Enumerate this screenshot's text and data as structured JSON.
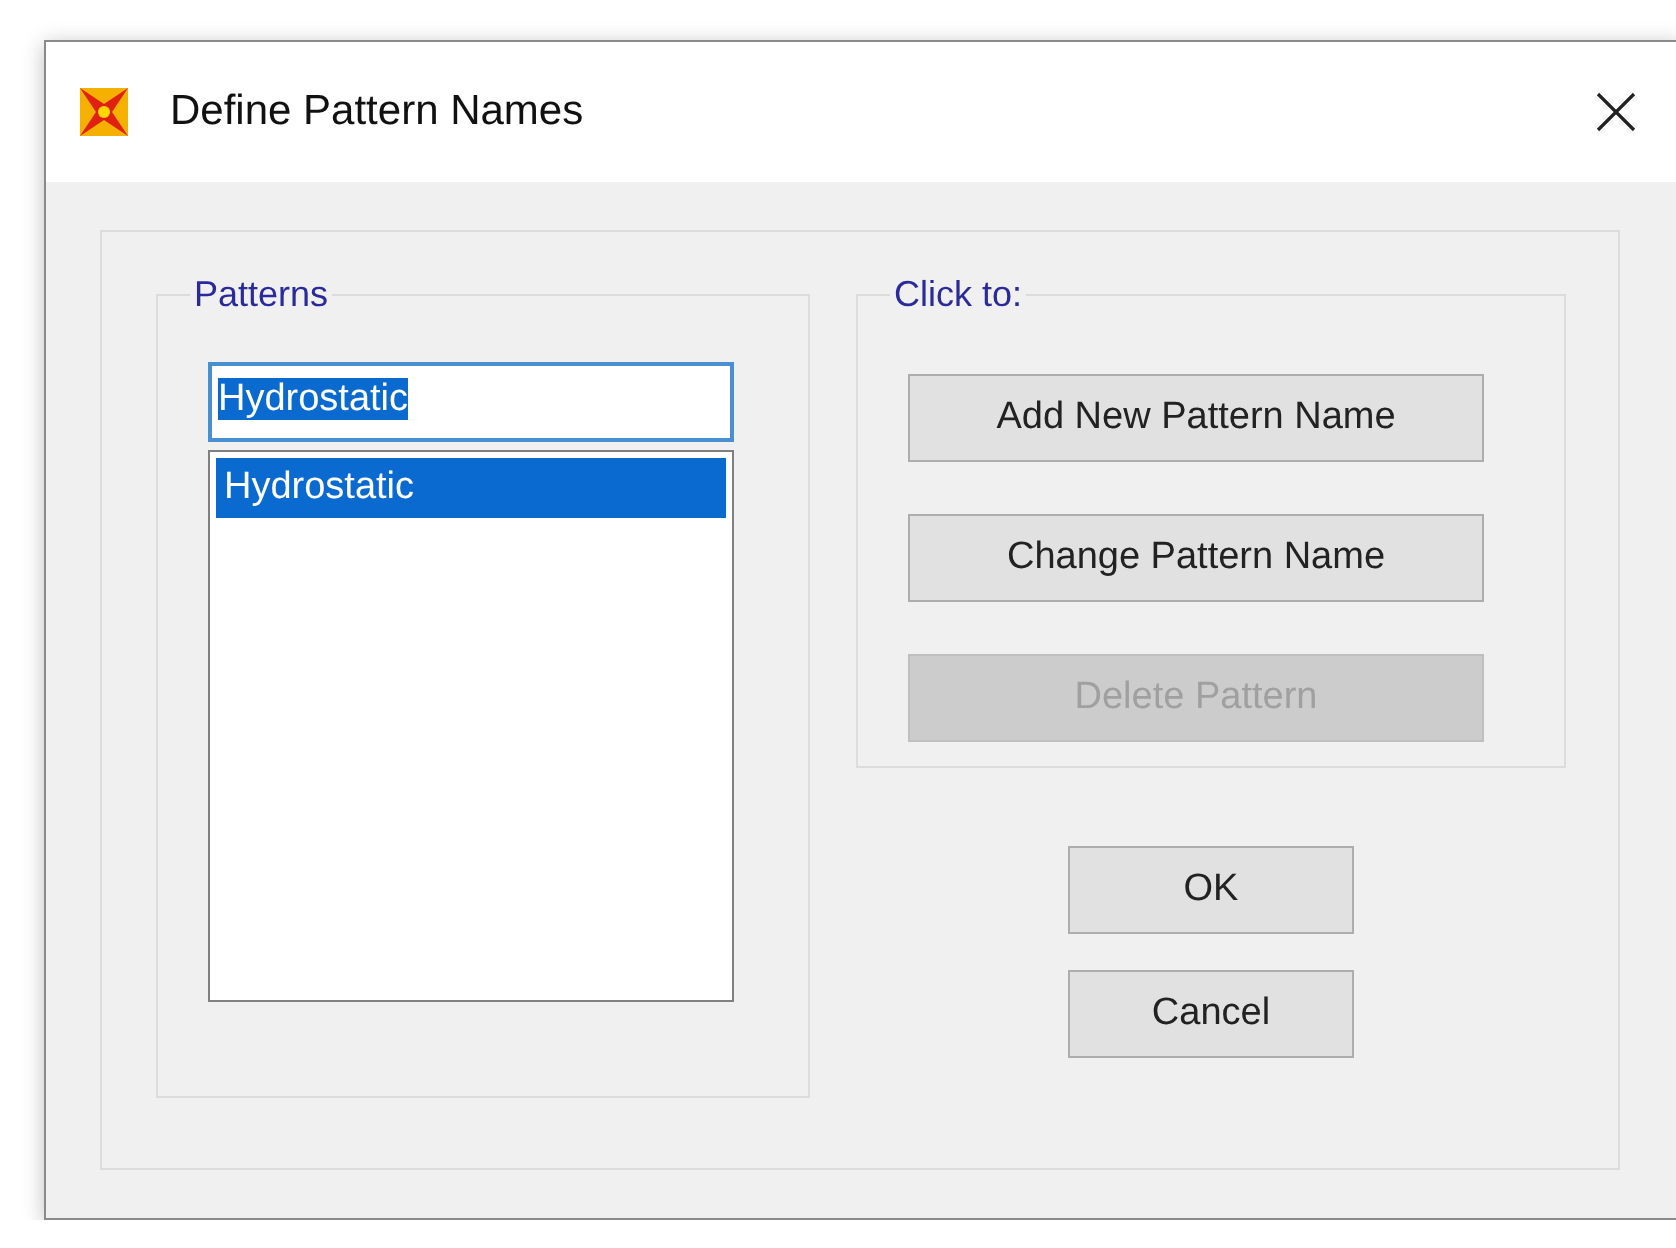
{
  "window": {
    "title": "Define Pattern Names"
  },
  "patterns": {
    "label": "Patterns",
    "name_field": {
      "value": "Hydrostatic",
      "text_selected": true
    },
    "list": [
      {
        "label": "Hydrostatic",
        "selected": true
      }
    ]
  },
  "actions": {
    "label": "Click to:",
    "buttons": [
      {
        "label": "Add New Pattern Name",
        "disabled": false
      },
      {
        "label": "Change Pattern Name",
        "disabled": false
      },
      {
        "label": "Delete Pattern",
        "disabled": true
      }
    ]
  },
  "dialog_buttons": [
    {
      "label": "OK"
    },
    {
      "label": "Cancel"
    }
  ]
}
